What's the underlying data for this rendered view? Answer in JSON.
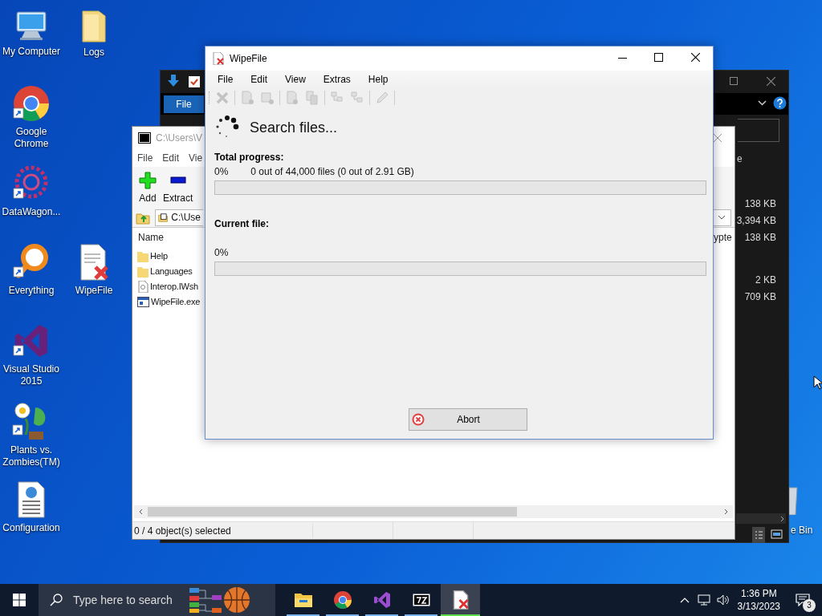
{
  "desktop_icons": [
    {
      "label": "My Computer"
    },
    {
      "label": "Logs"
    },
    {
      "label": "Google Chrome"
    },
    {
      "label": "DataWagon..."
    },
    {
      "label": "Everything"
    },
    {
      "label": "WipeFile"
    },
    {
      "label": "Visual Studio 2015"
    },
    {
      "label": "Plants vs. Zombies(TM)"
    },
    {
      "label": "Configuration"
    }
  ],
  "recycle_bin": {
    "label": "e Bin"
  },
  "explorer_window": {
    "tab": "File",
    "header_fragment": "e",
    "sizes": [
      "138 KB",
      "3,394 KB",
      "138 KB",
      "2 KB",
      "709 KB"
    ]
  },
  "archive_window": {
    "title": "C:\\Users\\V",
    "menu": [
      "File",
      "Edit",
      "Vie"
    ],
    "toolbar": [
      "Add",
      "Extract"
    ],
    "path": "C:\\Use",
    "columns": [
      "Name",
      "ypte"
    ],
    "files": [
      {
        "name": "Help",
        "kind": "folder"
      },
      {
        "name": "Languages",
        "kind": "folder"
      },
      {
        "name": "Interop.IWsh",
        "kind": "file"
      },
      {
        "name": "WipeFile.exe",
        "kind": "exe"
      }
    ],
    "status": "0 / 4 object(s) selected"
  },
  "wipefile_window": {
    "title": "WipeFile",
    "menu": [
      "File",
      "Edit",
      "View",
      "Extras",
      "Help"
    ],
    "toolbar": [
      {
        "disabled": true
      },
      {
        "disabled": true
      },
      {
        "disabled": true
      },
      {
        "disabled": true
      },
      {
        "disabled": true
      },
      {
        "disabled": true
      },
      {
        "disabled": true
      },
      {
        "disabled": true
      }
    ],
    "heading": "Search files...",
    "total": {
      "label": "Total progress:",
      "percent": "0%",
      "detail": "0 out of 44,000 files (0 out of 2.91 GB)",
      "level": 0
    },
    "current": {
      "label": "Current file:",
      "percent": "0%",
      "level": 0
    },
    "button": "Abort"
  },
  "taskbar": {
    "search_placeholder": "Type here to search",
    "apps": [
      {
        "selected": false
      },
      {
        "selected": false
      },
      {
        "selected": false
      },
      {
        "selected": false
      },
      {
        "selected": true
      }
    ],
    "time": "1:36 PM",
    "date": "3/13/2023",
    "notifications": "3"
  }
}
